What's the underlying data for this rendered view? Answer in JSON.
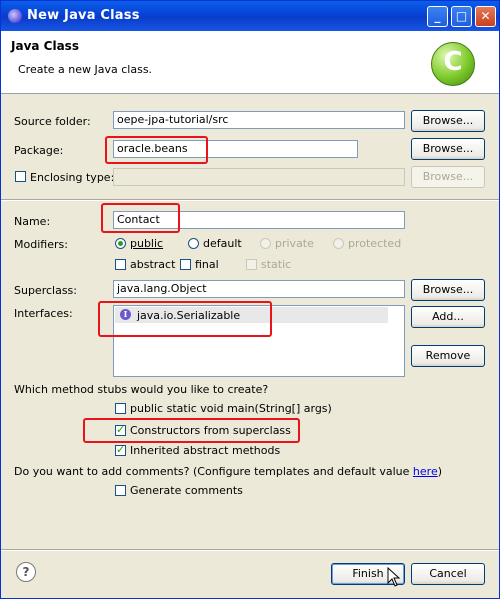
{
  "window": {
    "title": "New Java Class",
    "controls": {
      "minimize": "_",
      "maximize": "□",
      "close": "✕"
    }
  },
  "header": {
    "title": "Java Class",
    "description": "Create a new Java class.",
    "logo_letter": "C",
    "logo_icon": "java-class-icon"
  },
  "source_folder": {
    "label": "Source folder:",
    "value": "oepe-jpa-tutorial/src",
    "browse": "Browse..."
  },
  "package": {
    "label": "Package:",
    "value": "oracle.beans",
    "browse": "Browse..."
  },
  "enclosing_type": {
    "label": "Enclosing type:",
    "value": "",
    "browse": "Browse...",
    "checked": false
  },
  "name": {
    "label": "Name:",
    "value": "Contact"
  },
  "modifiers": {
    "label": "Modifiers:",
    "radios": [
      "public",
      "default",
      "private",
      "protected"
    ],
    "selected": "public",
    "checks": [
      "abstract",
      "final",
      "static"
    ]
  },
  "superclass": {
    "label": "Superclass:",
    "value": "java.lang.Object",
    "browse": "Browse..."
  },
  "interfaces": {
    "label": "Interfaces:",
    "items": [
      "java.io.Serializable"
    ],
    "add": "Add...",
    "remove": "Remove"
  },
  "stubs": {
    "question": "Which method stubs would you like to create?",
    "options": [
      {
        "label": "public static void main(String[] args)",
        "checked": false
      },
      {
        "label": "Constructors from superclass",
        "checked": true
      },
      {
        "label": "Inherited abstract methods",
        "checked": true
      }
    ]
  },
  "comments": {
    "question": "Do you want to add comments? (Configure templates and default value ",
    "link": "here",
    "suffix": ")",
    "option": "Generate comments"
  },
  "footer": {
    "help": "?",
    "finish": "Finish",
    "cancel": "Cancel"
  },
  "colors": {
    "highlight": "#e8141c",
    "title_bar": "#0a5ee8",
    "dialog_bg": "#ece9d8"
  }
}
